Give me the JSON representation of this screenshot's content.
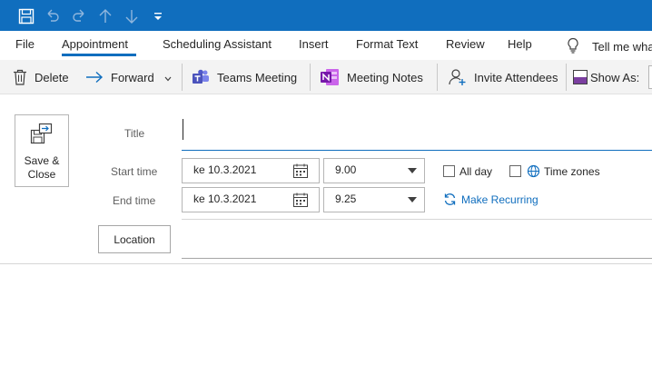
{
  "quick_access": {
    "icons": [
      "save-icon",
      "undo-icon",
      "redo-icon",
      "arrow-up-icon",
      "arrow-down-icon",
      "customize-qat-icon"
    ]
  },
  "tabs": [
    {
      "label": "File",
      "active": false
    },
    {
      "label": "Appointment",
      "active": true
    },
    {
      "label": "Scheduling Assistant",
      "active": false
    },
    {
      "label": "Insert",
      "active": false
    },
    {
      "label": "Format Text",
      "active": false
    },
    {
      "label": "Review",
      "active": false
    },
    {
      "label": "Help",
      "active": false
    }
  ],
  "tell_me": {
    "label": "Tell me wha",
    "icon": "lightbulb-icon"
  },
  "ribbon": {
    "delete": "Delete",
    "forward": "Forward",
    "teams_meeting": "Teams Meeting",
    "meeting_notes": "Meeting Notes",
    "invite_attendees": "Invite Attendees",
    "show_as": "Show As:"
  },
  "form": {
    "save_close_line1": "Save &",
    "save_close_line2": "Close",
    "title_label": "Title",
    "title_value": "",
    "start_label": "Start time",
    "start_date": "ke 10.3.2021",
    "start_time": "9.00",
    "end_label": "End time",
    "end_date": "ke 10.3.2021",
    "end_time": "9.25",
    "all_day": "All day",
    "all_day_checked": false,
    "time_zones": "Time zones",
    "time_zones_checked": false,
    "make_recurring": "Make Recurring",
    "location_button": "Location",
    "location_value": ""
  },
  "colors": {
    "accent": "#106ebe",
    "teams": "#5059c9",
    "onenote": "#7719aa"
  }
}
